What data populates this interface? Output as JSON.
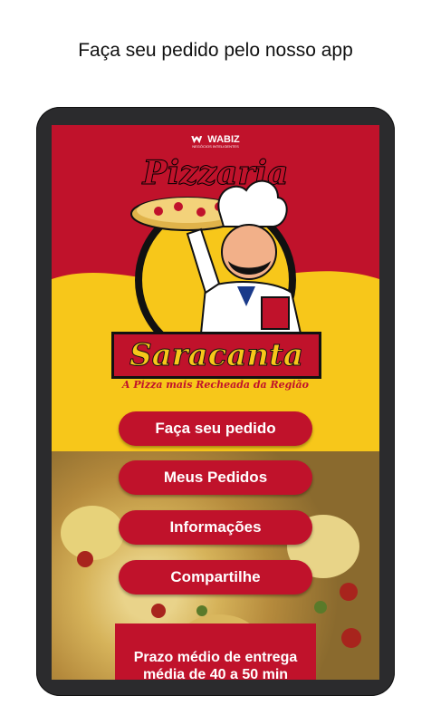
{
  "header": {
    "title": "Faça seu pedido pelo nosso app"
  },
  "brand": {
    "name": "WABIZ",
    "tagline": "NEGÓCIOS INTELIGENTES"
  },
  "logo": {
    "top_text": "Pizzaria",
    "name": "Saracanta",
    "tagline": "A Pizza mais Recheada da Região"
  },
  "menu": {
    "items": [
      {
        "label": "Faça seu pedido"
      },
      {
        "label": "Meus Pedidos"
      },
      {
        "label": "Informações"
      },
      {
        "label": "Compartilhe"
      }
    ]
  },
  "delivery": {
    "line1": "Prazo médio de entrega",
    "line2": "média de 40 a 50 min"
  },
  "colors": {
    "primary": "#c0122b",
    "accent": "#f7c71a",
    "device": "#2b2b2d"
  }
}
